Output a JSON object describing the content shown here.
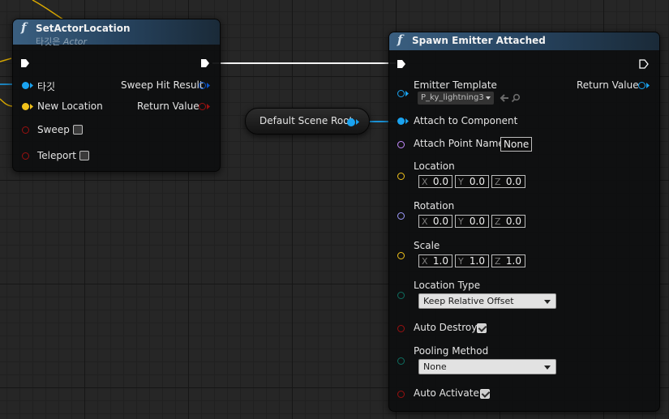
{
  "set_actor_location": {
    "title": "SetActorLocation",
    "subtitle_prefix": "타깃은",
    "subtitle_class": "Actor",
    "pins": {
      "target": "타깃",
      "new_location": "New Location",
      "sweep": "Sweep",
      "teleport": "Teleport",
      "sweep_hit_result": "Sweep Hit Result",
      "return_value": "Return Value"
    },
    "sweep_checked": false,
    "teleport_checked": false
  },
  "default_scene_root": {
    "label": "Default Scene Root"
  },
  "spawn_emitter_attached": {
    "title": "Spawn Emitter Attached",
    "pins": {
      "emitter_template": "Emitter Template",
      "return_value": "Return Value",
      "attach_to_component": "Attach to Component",
      "attach_point_name": "Attach Point Name",
      "location": "Location",
      "rotation": "Rotation",
      "scale": "Scale",
      "location_type": "Location Type",
      "auto_destroy": "Auto Destroy",
      "pooling_method": "Pooling Method",
      "auto_activate": "Auto Activate"
    },
    "emitter_template_value": "P_ky_lightning3",
    "attach_point_name_value": "None",
    "axis_labels": {
      "x": "X",
      "y": "Y",
      "z": "Z"
    },
    "location": {
      "x": "0.0",
      "y": "0.0",
      "z": "0.0"
    },
    "rotation": {
      "x": "0.0",
      "y": "0.0",
      "z": "0.0"
    },
    "scale": {
      "x": "1.0",
      "y": "1.0",
      "z": "1.0"
    },
    "location_type_value": "Keep Relative Offset",
    "pooling_method_value": "None",
    "auto_destroy_checked": true,
    "auto_activate_checked": true
  },
  "colors": {
    "exec": "#ffffff",
    "object": "#1aa3f0",
    "vector": "#f2c21b",
    "bool": "#9a1010",
    "name": "#c58cff",
    "rotator": "#a09cff",
    "enum": "#0f6e60",
    "struct": "#0a52c4"
  },
  "icons": {
    "function": "function-f-icon",
    "exec": "exec-arrow-icon",
    "browse": "browse-arrow-icon",
    "search": "search-icon"
  }
}
